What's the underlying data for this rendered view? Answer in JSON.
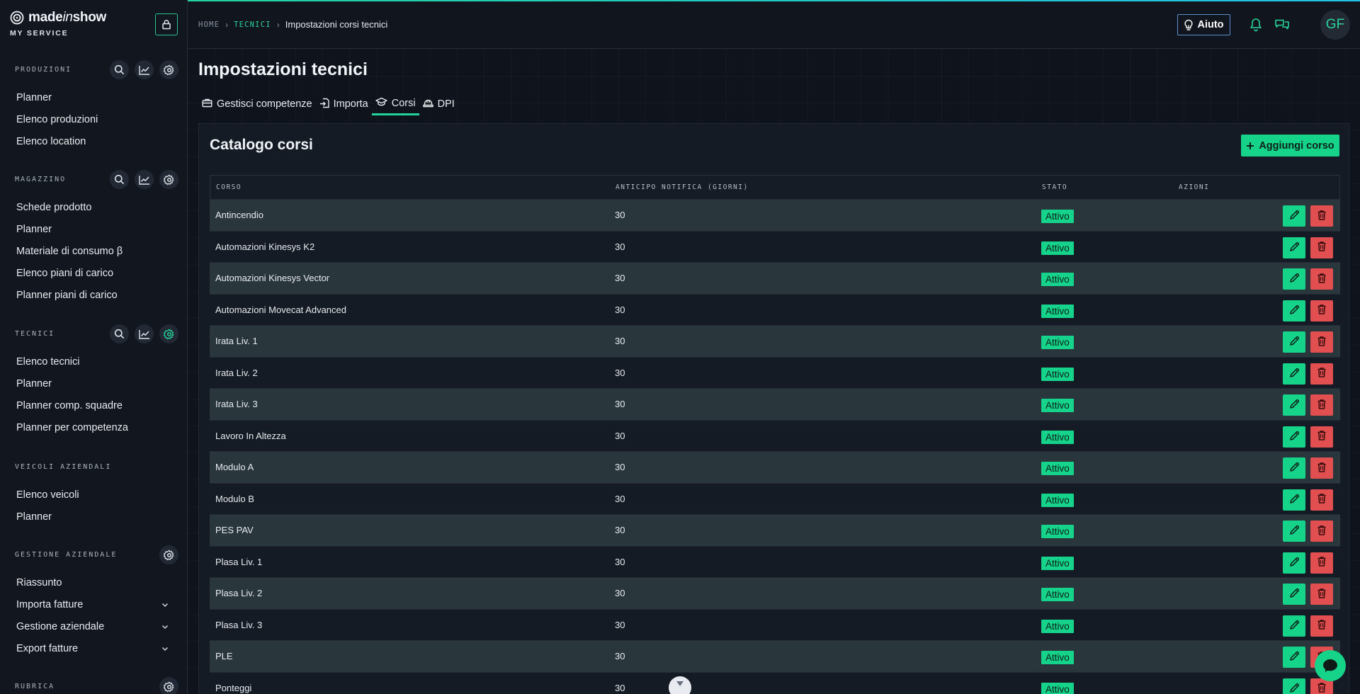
{
  "brand": {
    "name_prefix": "made",
    "name_italic": "in",
    "name_suffix": "show",
    "subtitle": "MY SERVICE"
  },
  "sidebar": {
    "sections": [
      {
        "title": "PRODUZIONI",
        "items": [
          "Planner",
          "Elenco produzioni",
          "Elenco location"
        ]
      },
      {
        "title": "MAGAZZINO",
        "items": [
          "Schede prodotto",
          "Planner",
          "Materiale di consumo β",
          "Elenco piani di carico",
          "Planner piani di carico"
        ]
      },
      {
        "title": "TECNICI",
        "items": [
          "Elenco tecnici",
          "Planner",
          "Planner comp. squadre",
          "Planner per competenza"
        ]
      },
      {
        "title": "VEICOLI AZIENDALI",
        "items": [
          "Elenco veicoli",
          "Planner"
        ]
      },
      {
        "title": "GESTIONE AZIENDALE",
        "items": [
          "Riassunto",
          "Importa fatture",
          "Gestione aziendale",
          "Export fatture"
        ]
      },
      {
        "title": "RUBRICA",
        "items": []
      }
    ]
  },
  "header": {
    "breadcrumb": {
      "home": "HOME",
      "section": "TECNICI",
      "current": "Impostazioni corsi tecnici"
    },
    "help_label": "Aiuto",
    "avatar_initials": "GF"
  },
  "main": {
    "title": "Impostazioni tecnici",
    "tabs": [
      {
        "label": "Gestisci competenze",
        "icon": "briefcase-icon"
      },
      {
        "label": "Importa",
        "icon": "import-icon"
      },
      {
        "label": "Corsi",
        "icon": "graduation-cap-icon",
        "active": true
      },
      {
        "label": "DPI",
        "icon": "helmet-icon"
      }
    ],
    "card_title": "Catalogo corsi",
    "add_button": "Aggiungi corso",
    "columns": [
      "CORSO",
      "ANTICIPO NOTIFICA (GIORNI)",
      "STATO",
      "AZIONI"
    ],
    "rows": [
      {
        "corso": "Antincendio",
        "anticipo": "30",
        "stato": "Attivo"
      },
      {
        "corso": "Automazioni Kinesys K2",
        "anticipo": "30",
        "stato": "Attivo"
      },
      {
        "corso": "Automazioni Kinesys Vector",
        "anticipo": "30",
        "stato": "Attivo"
      },
      {
        "corso": "Automazioni Movecat Advanced",
        "anticipo": "30",
        "stato": "Attivo"
      },
      {
        "corso": "Irata Liv. 1",
        "anticipo": "30",
        "stato": "Attivo"
      },
      {
        "corso": "Irata Liv. 2",
        "anticipo": "30",
        "stato": "Attivo"
      },
      {
        "corso": "Irata Liv. 3",
        "anticipo": "30",
        "stato": "Attivo"
      },
      {
        "corso": "Lavoro In Altezza",
        "anticipo": "30",
        "stato": "Attivo"
      },
      {
        "corso": "Modulo A",
        "anticipo": "30",
        "stato": "Attivo"
      },
      {
        "corso": "Modulo B",
        "anticipo": "30",
        "stato": "Attivo"
      },
      {
        "corso": "PES PAV",
        "anticipo": "30",
        "stato": "Attivo"
      },
      {
        "corso": "Plasa Liv. 1",
        "anticipo": "30",
        "stato": "Attivo"
      },
      {
        "corso": "Plasa Liv. 2",
        "anticipo": "30",
        "stato": "Attivo"
      },
      {
        "corso": "Plasa Liv. 3",
        "anticipo": "30",
        "stato": "Attivo"
      },
      {
        "corso": "PLE",
        "anticipo": "30",
        "stato": "Attivo"
      },
      {
        "corso": "Ponteggi",
        "anticipo": "30",
        "stato": "Attivo"
      }
    ]
  },
  "colors": {
    "accent": "#16d38a",
    "danger": "#e24f50",
    "row_alt": "#29373d",
    "background": "#0f141c"
  }
}
